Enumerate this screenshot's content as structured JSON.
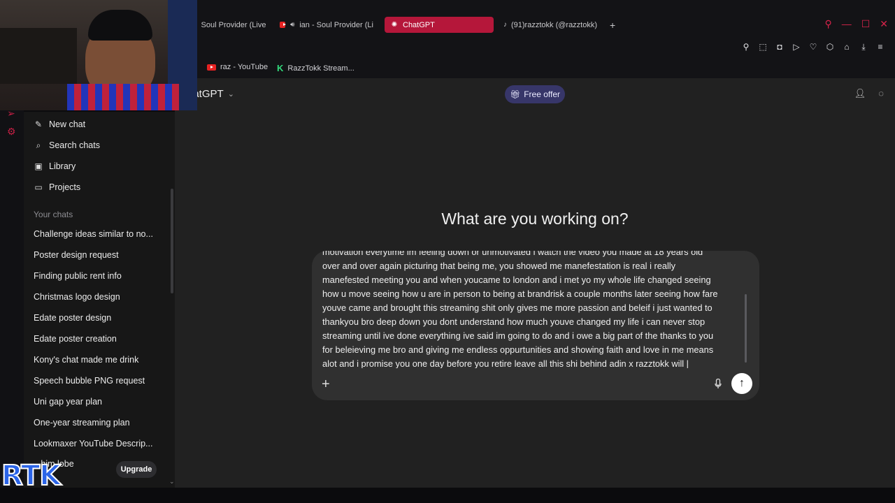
{
  "browser": {
    "tabs": [
      {
        "label": "Soul Provider (Live P",
        "icon": "globe-icon",
        "active": false
      },
      {
        "label": "ian - Soul Provider (Li",
        "icon": "youtube-icon",
        "active": false
      },
      {
        "label": "ChatGPT",
        "icon": "chatgpt-icon",
        "active": true
      },
      {
        "label": "(91)razztokk (@razztokk)",
        "icon": "tiktok-icon",
        "active": false
      }
    ],
    "new_tab_symbol": "+",
    "bookmarks": [
      {
        "label": "raz - YouTube",
        "icon": "youtube-icon"
      },
      {
        "label": "RazzTokk Stream...",
        "icon": "kick-icon"
      }
    ],
    "bookmark_k": "K"
  },
  "sidebar": {
    "actions": [
      {
        "label": "New chat",
        "icon": "new-chat-icon",
        "glyph": "✎"
      },
      {
        "label": "Search chats",
        "icon": "search-icon",
        "glyph": "⌕"
      },
      {
        "label": "Library",
        "icon": "library-icon",
        "glyph": "▣"
      },
      {
        "label": "Projects",
        "icon": "projects-icon",
        "glyph": "▭"
      }
    ],
    "section_label": "Your chats",
    "chats": [
      "Challenge ideas similar to no...",
      "Poster design request",
      "Finding public rent info",
      "Christmas logo design",
      "Edate poster design",
      "Edate poster creation",
      "Kony's chat made me drink",
      "Speech bubble PNG request",
      "Uni gap year plan",
      "One-year streaming plan",
      "Lookmaxer YouTube Descrip...",
      "...him lobe"
    ],
    "upgrade_label": "Upgrade"
  },
  "header": {
    "model_label": "hatGPT",
    "offer_label": "Free offer"
  },
  "main": {
    "heading": "What are you working on?",
    "composer_lines": [
      "motivation everytime im feeling down or unmotivated i watch the video you made at 18 years old",
      "over and over again picturing that being me, you showed me manefestation is real i really",
      "manefested meeting you and when youcame to london and i met yo my whole life changed seeing",
      "how u move seeing how u are in person to being at brandrisk a couple months later seeing how fare",
      "youve came and brought this streaming shit only gives me more passion and beleif i just wanted to",
      "thankyou bro deep down you dont understand how much youve changed my life i can never stop",
      "streaming until ive done everything ive said im going to do and i owe a big part of the thanks to you",
      "for beleieving me bro and giving me endless oppurtunities and showing faith and love in me means",
      "alot and i promise you one day before you retire leave all this shi behind adin x razztokk will |"
    ]
  },
  "overlay": {
    "logo_text": "RTK"
  },
  "colors": {
    "accent_tab": "#b5173a",
    "offer_bg": "#373669",
    "sidebar_bg": "#171717",
    "main_bg": "#212121",
    "composer_bg": "#303030"
  }
}
